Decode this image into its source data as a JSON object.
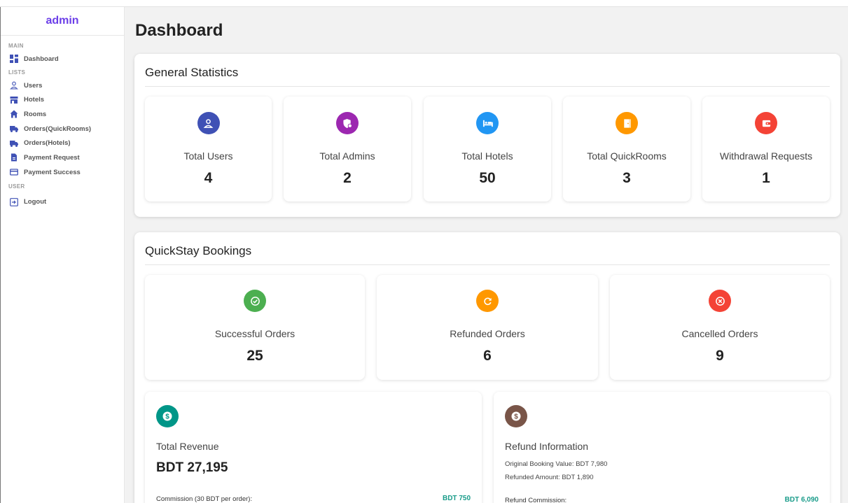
{
  "sidebar": {
    "brand": "admin",
    "sections": {
      "main": "MAIN",
      "lists": "LISTS",
      "user": "USER"
    },
    "items": [
      {
        "label": "Dashboard",
        "icon": "dashboard-icon"
      },
      {
        "label": "Users",
        "icon": "user-icon"
      },
      {
        "label": "Hotels",
        "icon": "store-icon"
      },
      {
        "label": "Rooms",
        "icon": "home-icon"
      },
      {
        "label": "Orders(QuickRooms)",
        "icon": "truck-icon"
      },
      {
        "label": "Orders(Hotels)",
        "icon": "truck-icon"
      },
      {
        "label": "Payment Request",
        "icon": "document-icon"
      },
      {
        "label": "Payment Success",
        "icon": "credit-card-icon"
      },
      {
        "label": "Logout",
        "icon": "logout-icon"
      }
    ]
  },
  "page_title": "Dashboard",
  "general": {
    "title": "General Statistics",
    "cards": [
      {
        "label": "Total Users",
        "value": "4",
        "color": "#3f51b5",
        "icon": "person-icon"
      },
      {
        "label": "Total Admins",
        "value": "2",
        "color": "#9c27b0",
        "icon": "admin-shield-icon"
      },
      {
        "label": "Total Hotels",
        "value": "50",
        "color": "#2196f3",
        "icon": "hotel-bed-icon"
      },
      {
        "label": "Total QuickRooms",
        "value": "3",
        "color": "#ff9800",
        "icon": "door-icon"
      },
      {
        "label": "Withdrawal Requests",
        "value": "1",
        "color": "#f44336",
        "icon": "wallet-icon"
      }
    ]
  },
  "bookings": {
    "title": "QuickStay Bookings",
    "cards": [
      {
        "label": "Successful Orders",
        "value": "25",
        "color": "#4caf50",
        "icon": "check-circle-icon"
      },
      {
        "label": "Refunded Orders",
        "value": "6",
        "color": "#ff9800",
        "icon": "refresh-icon"
      },
      {
        "label": "Cancelled Orders",
        "value": "9",
        "color": "#f44336",
        "icon": "cancel-circle-icon"
      }
    ],
    "revenue": {
      "title": "Total Revenue",
      "value": "BDT 27,195",
      "color": "#009688",
      "icon": "dollar-circle-icon",
      "commission_label": "Commission (30 BDT per order):",
      "commission_value": "BDT 750"
    },
    "refund": {
      "title": "Refund Information",
      "color": "#795548",
      "icon": "dollar-circle-icon",
      "original_booking": "Original Booking Value: BDT 7,980",
      "refunded_amount": "Refunded Amount: BDT 1,890",
      "commission_label": "Refund Commission:",
      "commission_value": "BDT 6,090"
    }
  }
}
